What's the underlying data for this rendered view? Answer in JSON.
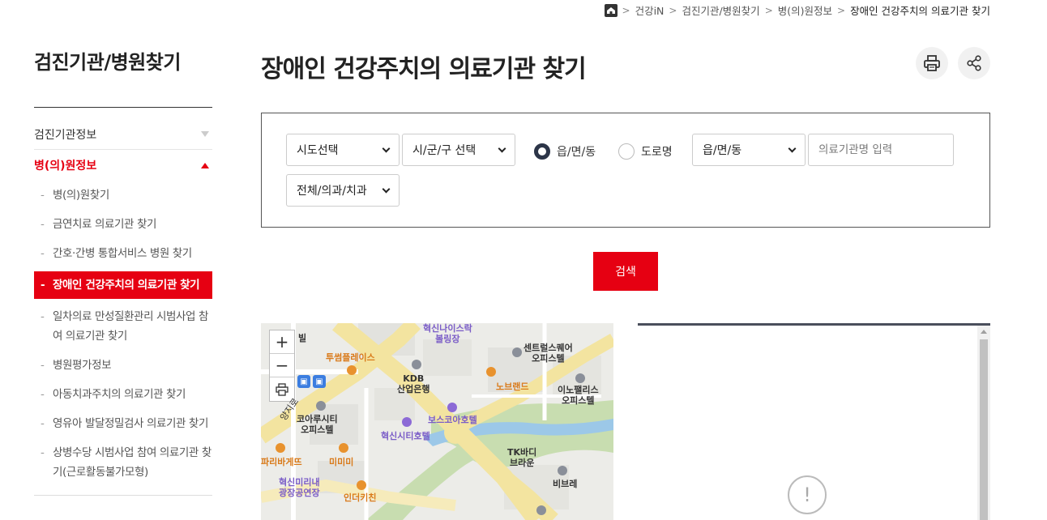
{
  "breadcrumb": {
    "items": [
      "건강iN",
      "검진기관/병원찾기",
      "병(의)원정보"
    ],
    "current": "장애인 건강주치의 의료기관 찾기"
  },
  "sidebar": {
    "title": "검진기관/병원찾기",
    "menu": [
      {
        "label": "검진기관정보",
        "state": "collapsed"
      },
      {
        "label": "병(의)원정보",
        "state": "expanded"
      }
    ],
    "submenu": [
      "병(의)원찾기",
      "금연치료 의료기관 찾기",
      "간호·간병 통합서비스 병원 찾기",
      "장애인 건강주치의 의료기관 찾기",
      "일차의료 만성질환관리 시범사업 참여 의료기관 찾기",
      "병원평가정보",
      "아동치과주치의 의료기관 찾기",
      "영유아 발달정밀검사 의료기관 찾기",
      "상병수당 시범사업 참여 의료기관 찾기(근로활동불가모형)"
    ]
  },
  "main": {
    "title": "장애인 건강주치의 의료기관 찾기",
    "print_icon": "print-icon",
    "share_icon": "share-icon"
  },
  "search": {
    "sido": "시도선택",
    "sigungu": "시/군/구 선택",
    "radio_eup": "읍/면/동",
    "radio_road": "도로명",
    "eup_select": "읍/면/동",
    "name_placeholder": "의료기관명 입력",
    "type_select": "전체/의과/치과",
    "button": "검색"
  },
  "map": {
    "zoom_in": "+",
    "zoom_out": "−",
    "labels": {
      "hyukshin_nice": "혁신나이스락\n볼링장",
      "twosome": "투썸플레이스",
      "kdb": "KDB\n산업은행",
      "central": "센트럴스퀘어\n오피스텔",
      "nobrand": "노브랜드",
      "innopalace": "이노팰리스\n오피스텔",
      "korea_city": "코아루시티\n오피스텔",
      "boss_coa": "보스코아호텔",
      "hyukshin_city": "혁신시티호텔",
      "tk_body": "TK바디\n브라운",
      "paris": "파리바게뜨",
      "mimimi": "미미미",
      "hyukshin_mirinae": "혁신미리내\n광장공연장",
      "indi": "인더키친",
      "bibre": "비브레",
      "road": "양지로",
      "bil": "빌"
    }
  },
  "colors": {
    "accent": "#e60012",
    "radio_on": "#2c3548"
  }
}
